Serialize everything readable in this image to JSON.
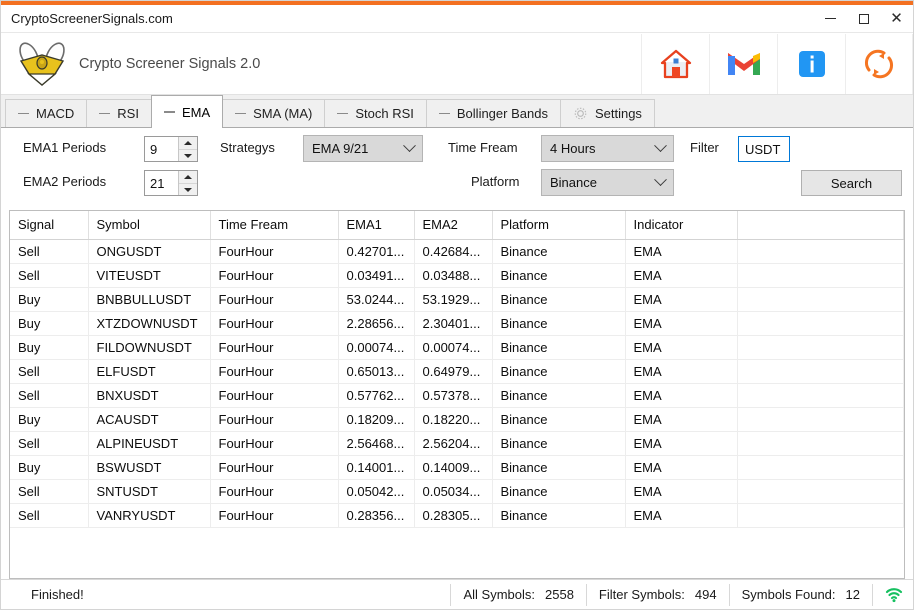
{
  "window": {
    "title": "CryptoScreenerSignals.com",
    "accent_color": "#F37021",
    "minimize_label": "Minimize",
    "maximize_label": "Maximize",
    "close_label": "Close"
  },
  "header": {
    "app_name": "Crypto Screener Signals 2.0",
    "logo_name": "bee-logo",
    "icons": [
      {
        "name": "home-icon",
        "label": "Home"
      },
      {
        "name": "gmail-icon",
        "label": "M"
      },
      {
        "name": "info-icon",
        "label": "i"
      },
      {
        "name": "refresh-icon",
        "label": "Refresh"
      }
    ]
  },
  "tabs": [
    {
      "label": "MACD",
      "icon": "dash-icon",
      "active": false
    },
    {
      "label": "RSI",
      "icon": "dash-icon",
      "active": false
    },
    {
      "label": "EMA",
      "icon": "dash-icon",
      "active": true
    },
    {
      "label": "SMA (MA)",
      "icon": "dash-icon",
      "active": false
    },
    {
      "label": "Stoch RSI",
      "icon": "dash-icon",
      "active": false
    },
    {
      "label": "Bollinger Bands",
      "icon": "dash-icon",
      "active": false
    },
    {
      "label": "Settings",
      "icon": "gear-icon",
      "active": false
    }
  ],
  "controls": {
    "ema1_label": "EMA1 Periods",
    "ema1_value": "9",
    "ema2_label": "EMA2 Periods",
    "ema2_value": "21",
    "strategys_label": "Strategys",
    "strategys_value": "EMA 9/21",
    "timeframe_label": "Time Fream",
    "timeframe_value": "4 Hours",
    "platform_label": "Platform",
    "platform_value": "Binance",
    "filter_label": "Filter",
    "filter_value": "USDT",
    "search_label": "Search"
  },
  "grid": {
    "columns": [
      "Signal",
      "Symbol",
      "Time Fream",
      "EMA1",
      "EMA2",
      "Platform",
      "Indicator",
      ""
    ],
    "rows": [
      [
        "Sell",
        "ONGUSDT",
        "FourHour",
        "0.42701...",
        "0.42684...",
        "Binance",
        "EMA",
        ""
      ],
      [
        "Sell",
        "VITEUSDT",
        "FourHour",
        "0.03491...",
        "0.03488...",
        "Binance",
        "EMA",
        ""
      ],
      [
        "Buy",
        "BNBBULLUSDT",
        "FourHour",
        "53.0244...",
        "53.1929...",
        "Binance",
        "EMA",
        ""
      ],
      [
        "Buy",
        "XTZDOWNUSDT",
        "FourHour",
        "2.28656...",
        "2.30401...",
        "Binance",
        "EMA",
        ""
      ],
      [
        "Buy",
        "FILDOWNUSDT",
        "FourHour",
        "0.00074...",
        "0.00074...",
        "Binance",
        "EMA",
        ""
      ],
      [
        "Sell",
        "ELFUSDT",
        "FourHour",
        "0.65013...",
        "0.64979...",
        "Binance",
        "EMA",
        ""
      ],
      [
        "Sell",
        "BNXUSDT",
        "FourHour",
        "0.57762...",
        "0.57378...",
        "Binance",
        "EMA",
        ""
      ],
      [
        "Buy",
        "ACAUSDT",
        "FourHour",
        "0.18209...",
        "0.18220...",
        "Binance",
        "EMA",
        ""
      ],
      [
        "Sell",
        "ALPINEUSDT",
        "FourHour",
        "2.56468...",
        "2.56204...",
        "Binance",
        "EMA",
        ""
      ],
      [
        "Buy",
        "BSWUSDT",
        "FourHour",
        "0.14001...",
        "0.14009...",
        "Binance",
        "EMA",
        ""
      ],
      [
        "Sell",
        "SNTUSDT",
        "FourHour",
        "0.05042...",
        "0.05034...",
        "Binance",
        "EMA",
        ""
      ],
      [
        "Sell",
        "VANRYUSDT",
        "FourHour",
        "0.28356...",
        "0.28305...",
        "Binance",
        "EMA",
        ""
      ]
    ]
  },
  "status": {
    "message": "Finished!",
    "all_symbols_label": "All Symbols:",
    "all_symbols_value": "2558",
    "filter_symbols_label": "Filter Symbols:",
    "filter_symbols_value": "494",
    "symbols_found_label": "Symbols Found:",
    "symbols_found_value": "12",
    "connection_icon": "wifi-icon",
    "connection_color": "#16c060"
  }
}
